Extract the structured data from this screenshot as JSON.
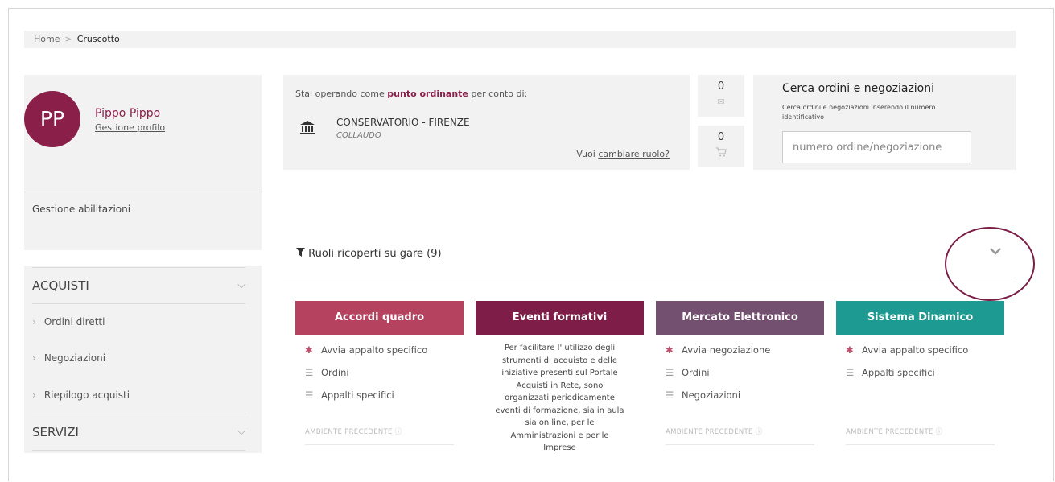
{
  "breadcrumb": {
    "home": "Home",
    "separator": ">",
    "current": "Cruscotto"
  },
  "profile": {
    "initials": "PP",
    "name": "Pippo Pippo",
    "manage_link": "Gestione profilo",
    "abilitazioni": "Gestione abilitazioni",
    "avatar_color": "#8a1f4a"
  },
  "menu": {
    "sections": [
      {
        "label": "ACQUISTI",
        "items": [
          "Ordini diretti",
          "Negoziazioni",
          "Riepilogo acquisti"
        ]
      },
      {
        "label": "SERVIZI",
        "items": []
      }
    ]
  },
  "operating": {
    "prefix": "Stai operando come",
    "role": "punto ordinante",
    "suffix": "per conto di:",
    "ente": "CONSERVATORIO - FIRENZE",
    "environment": "COLLAUDO",
    "change_prefix": "Vuoi",
    "change_link": "cambiare ruolo?"
  },
  "counters": {
    "messages": {
      "count": "0",
      "icon": "envelope-icon"
    },
    "cart": {
      "count": "0",
      "icon": "cart-icon"
    }
  },
  "search": {
    "title": "Cerca ordini e negoziazioni",
    "subtitle": "Cerca ordini e negoziazioni inserendo il numero identificativo",
    "placeholder": "numero ordine/negoziazione"
  },
  "roles": {
    "label": "Ruoli ricoperti su gare (9)",
    "icon": "filter-icon"
  },
  "cards": [
    {
      "title": "Accordi quadro",
      "color": "#b5425f",
      "items": [
        "Avvia appalto specifico",
        "Ordini",
        "Appalti specifici"
      ],
      "ambiente": "AMBIENTE PRECEDENTE ⓘ"
    },
    {
      "title": "Eventi formativi",
      "color": "#7f1d49",
      "description": "Per facilitare l' utilizzo degli strumenti di acquisto e delle iniziative presenti sul Portale Acquisti in Rete, sono organizzati periodicamente eventi di formazione, sia in aula sia on line, per le Amministrazioni e per le Imprese"
    },
    {
      "title": "Mercato Elettronico",
      "color": "#73506f",
      "items": [
        "Avvia negoziazione",
        "Ordini",
        "Negoziazioni"
      ],
      "ambiente": "AMBIENTE PRECEDENTE ⓘ"
    },
    {
      "title": "Sistema Dinamico",
      "color": "#1d9a92",
      "items": [
        "Avvia appalto specifico",
        "Appalti specifici"
      ],
      "ambiente": "AMBIENTE PRECEDENTE ⓘ"
    }
  ]
}
